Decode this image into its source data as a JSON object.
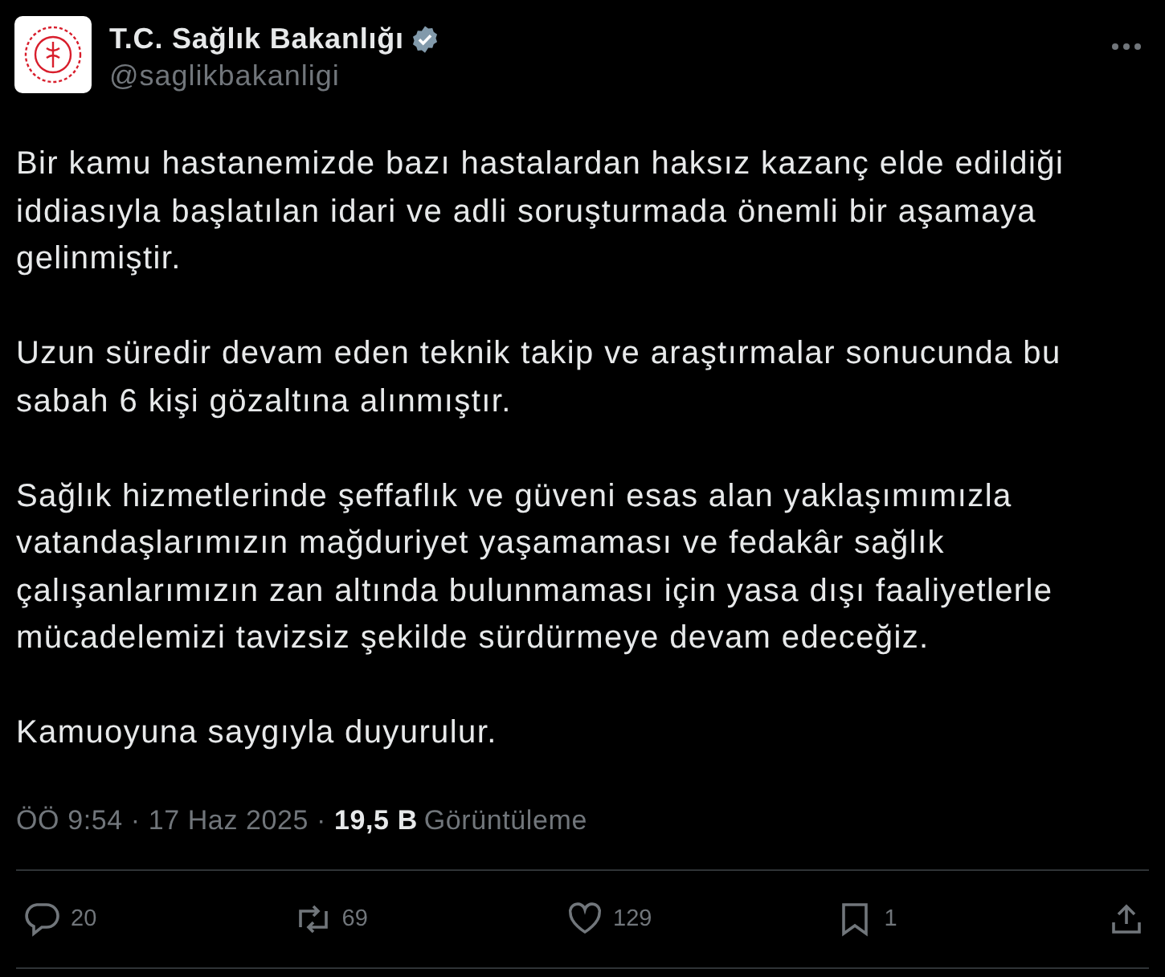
{
  "author": {
    "name": "T.C. Sağlık Bakanlığı",
    "verified": true,
    "handle": "@saglikbakanligi"
  },
  "paragraphs": [
    "Bir kamu hastanemizde bazı hastalardan haksız kazanç elde edildiği iddiasıyla başlatılan idari ve adli soruşturmada önemli bir aşamaya gelinmiştir.",
    "Uzun süredir devam eden teknik takip ve araştırmalar sonucunda bu sabah 6 kişi gözaltına alınmıştır.",
    "Sağlık hizmetlerinde şeffaflık ve güveni esas alan yaklaşımımızla vatandaşlarımızın mağduriyet yaşamaması ve fedakâr sağlık çalışanlarımızın zan altında bulunmaması için yasa dışı faaliyetlerle mücadelemizi tavizsiz şekilde sürdürmeye devam edeceğiz.",
    "Kamuoyuna saygıyla duyurulur."
  ],
  "meta": {
    "time": "ÖÖ 9:54",
    "separator_1": "·",
    "date": "17 Haz 2025",
    "separator_2": "·",
    "views": "19,5 B",
    "views_label": "Görüntüleme"
  },
  "actions": [
    {
      "kind": "reply",
      "count": "20"
    },
    {
      "kind": "repost",
      "count": "69"
    },
    {
      "kind": "like",
      "count": "129"
    },
    {
      "kind": "bookmark",
      "count": "1"
    },
    {
      "kind": "share"
    }
  ]
}
